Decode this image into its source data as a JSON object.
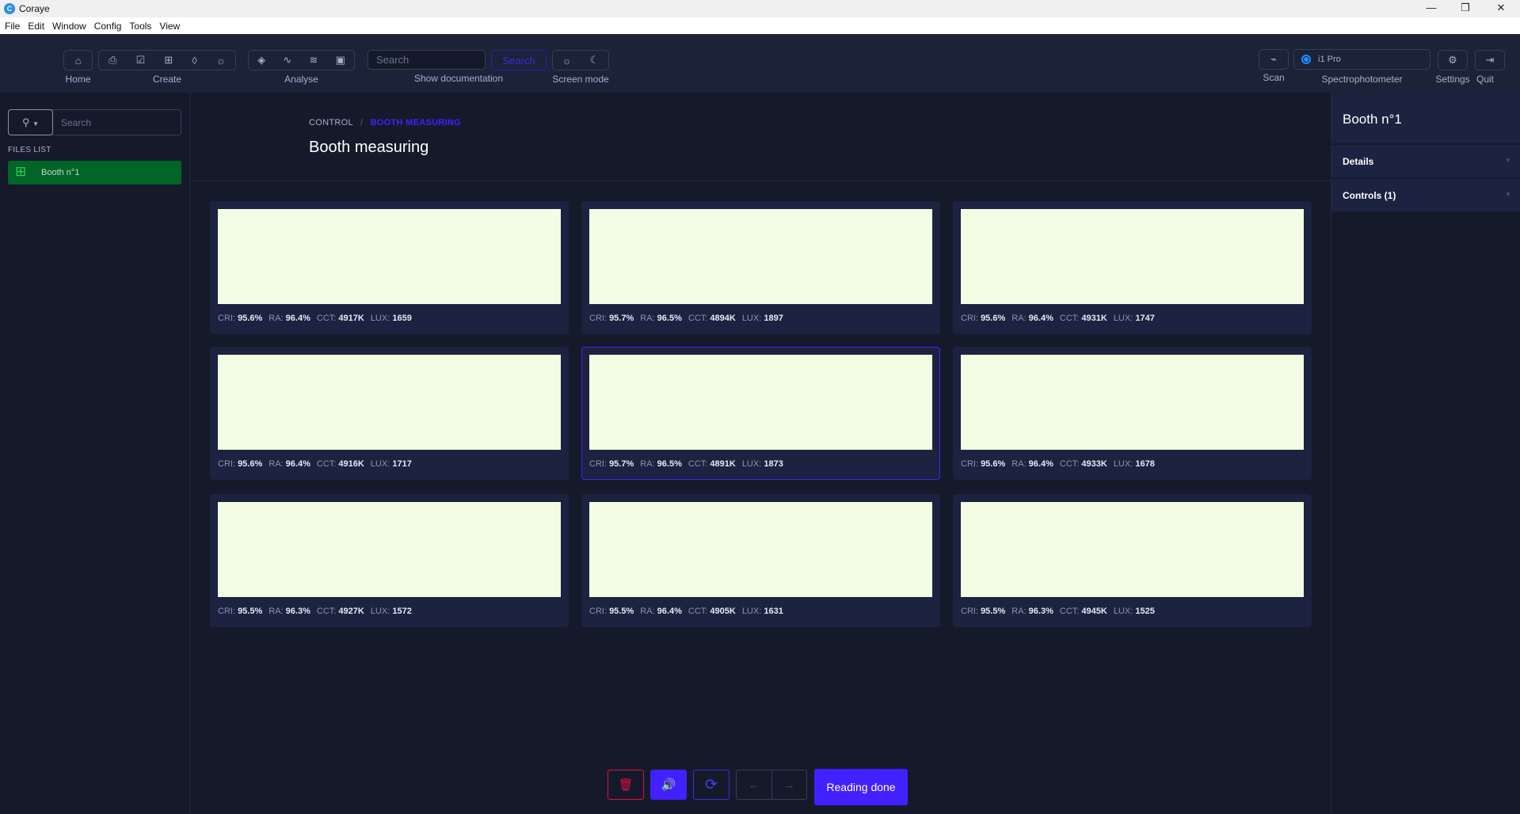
{
  "app": {
    "title": "Coraye",
    "logo": "C"
  },
  "window_controls": {
    "minimize": "—",
    "restore": "❐",
    "close": "✕"
  },
  "menu": [
    "File",
    "Edit",
    "Window",
    "Config",
    "Tools",
    "View"
  ],
  "toolbar": {
    "home": "Home",
    "create": "Create",
    "analyse": "Analyse",
    "search_placeholder": "Search",
    "search_button": "Search",
    "show_doc": "Show documentation",
    "screen_mode": "Screen mode",
    "scan": "Scan",
    "device": "i1 Pro",
    "spectro": "Spectrophotometer",
    "settings": "Settings",
    "quit": "Quit"
  },
  "sidebar": {
    "search_placeholder": "Search",
    "files_label": "FILES LIST",
    "files": [
      {
        "label": "Booth n°1",
        "active": true
      }
    ]
  },
  "breadcrumb": {
    "parent": "CONTROL",
    "sep": "/",
    "current": "BOOTH MEASURING"
  },
  "page_title": "Booth measuring",
  "labels": {
    "cri": "CRI:",
    "ra": "RA:",
    "cct": "CCT:",
    "lux": "LUX:"
  },
  "swatch_color": "#f3fde3",
  "accent": "#4320ff",
  "measurements": [
    {
      "cri": "95.6%",
      "ra": "96.4%",
      "cct": "4917K",
      "lux": "1659"
    },
    {
      "cri": "95.7%",
      "ra": "96.5%",
      "cct": "4894K",
      "lux": "1897"
    },
    {
      "cri": "95.6%",
      "ra": "96.4%",
      "cct": "4931K",
      "lux": "1747"
    },
    {
      "cri": "95.6%",
      "ra": "96.4%",
      "cct": "4916K",
      "lux": "1717"
    },
    {
      "cri": "95.7%",
      "ra": "96.5%",
      "cct": "4891K",
      "lux": "1873",
      "selected": true
    },
    {
      "cri": "95.6%",
      "ra": "96.4%",
      "cct": "4933K",
      "lux": "1678"
    },
    {
      "cri": "95.5%",
      "ra": "96.3%",
      "cct": "4927K",
      "lux": "1572"
    },
    {
      "cri": "95.5%",
      "ra": "96.4%",
      "cct": "4905K",
      "lux": "1631"
    },
    {
      "cri": "95.5%",
      "ra": "96.3%",
      "cct": "4945K",
      "lux": "1525"
    }
  ],
  "right_panel": {
    "title": "Booth n°1",
    "sections": [
      "Details",
      "Controls (1)"
    ]
  },
  "actions": {
    "reading_done": "Reading done"
  }
}
